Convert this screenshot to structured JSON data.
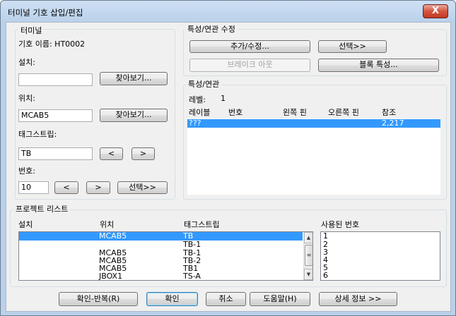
{
  "window": {
    "title": "터미널 기호 삽입/편집",
    "close_glyph": "X"
  },
  "terminal": {
    "group_label": "터미널",
    "symbol_name_label": "기호 이름: HT0002",
    "install_label": "설치:",
    "install_value": "",
    "browse1": "찾아보기...",
    "location_label": "위치:",
    "location_value": "MCAB5",
    "browse2": "찾아보기...",
    "tagstrip_label": "태그스트립:",
    "tagstrip_value": "TB",
    "prev": "<",
    "next": ">",
    "number_label": "번호:",
    "number_value": "10",
    "num_prev": "<",
    "num_next": ">",
    "select": "선택>>"
  },
  "props_edit": {
    "group_label": "특성/연관 수정",
    "add_edit": "추가/수정...",
    "select": "선택>>",
    "break_link": "브레이크 아웃",
    "block_props": "블록 특성..."
  },
  "props": {
    "group_label": "특성/연관",
    "level_label": "레벨:",
    "level_value": "1",
    "columns": [
      "레이블",
      "번호",
      "왼쪽 핀",
      "오른쪽 핀",
      "참조"
    ],
    "rows": [
      {
        "label": "???",
        "number": "",
        "left": "",
        "right": "",
        "ref": "2,217",
        "selected": true
      }
    ]
  },
  "project": {
    "group_label": "프로젝트 리스트",
    "columns": [
      "설치",
      "위치",
      "태그스트립"
    ],
    "rows": [
      {
        "install": "",
        "location": "MCAB5",
        "tagstrip": "TB",
        "selected": true
      },
      {
        "install": "",
        "location": "",
        "tagstrip": "TB-1",
        "selected": false
      },
      {
        "install": "",
        "location": "MCAB5",
        "tagstrip": "TB-1",
        "selected": false
      },
      {
        "install": "",
        "location": "MCAB5",
        "tagstrip": "TB-2",
        "selected": false
      },
      {
        "install": "",
        "location": "MCAB5",
        "tagstrip": "TB1",
        "selected": false
      },
      {
        "install": "",
        "location": "JBOX1",
        "tagstrip": "TS-A",
        "selected": false
      }
    ],
    "used_label": "사용된 번호",
    "used_numbers": [
      "1",
      "2",
      "3",
      "4",
      "5",
      "6"
    ]
  },
  "footer": {
    "ok_repeat": "확인-반복(R)",
    "ok": "확인",
    "cancel": "취소",
    "help": "도움말(H)",
    "details": "상세 정보 >>"
  }
}
